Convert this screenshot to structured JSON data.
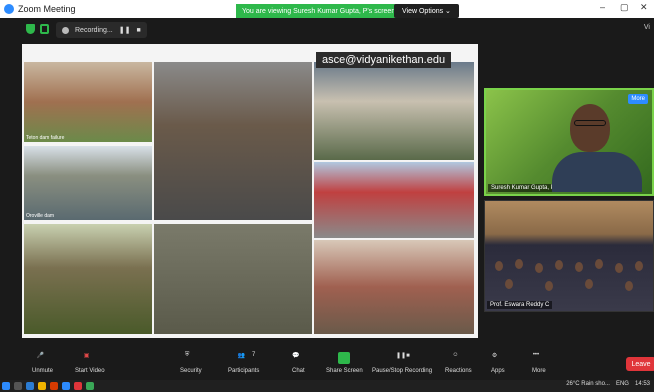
{
  "window": {
    "title": "Zoom Meeting"
  },
  "banner": {
    "text": "You are viewing Suresh Kumar Gupta, P's screen"
  },
  "view_options": {
    "label": "View Options ⌄"
  },
  "recording": {
    "label": "Recording..."
  },
  "top_right": {
    "view_label": "Vi"
  },
  "slide": {
    "title": "asce@vidyanikethan.edu",
    "photos": [
      {
        "caption": "Teton dam failure"
      },
      {
        "caption": "Oroville dam"
      },
      {
        "caption": ""
      },
      {
        "caption": ""
      },
      {
        "caption": ""
      },
      {
        "caption": ""
      },
      {
        "caption": ""
      },
      {
        "caption": ""
      },
      {
        "caption": ""
      }
    ]
  },
  "participants": {
    "speaker": {
      "name": "Suresh Kumar Gupta, P",
      "more": "More"
    },
    "audience": {
      "name": "Prof. Eswara Reddy C"
    }
  },
  "toolbar": {
    "unmute": "Unmute",
    "start_video": "Start Video",
    "security": "Security",
    "participants": "Participants",
    "participant_count": "7",
    "chat": "Chat",
    "share_screen": "Share Screen",
    "pause_stop_recording": "Pause/Stop Recording",
    "reactions": "Reactions",
    "apps": "Apps",
    "more": "More",
    "leave": "Leave"
  },
  "taskbar": {
    "weather": "26°C Rain sho...",
    "language": "ENG",
    "time": "14:53"
  },
  "colors": {
    "share_green": "#2eb84b",
    "leave_red": "#e0353a",
    "zoom_blue": "#2d8cff"
  }
}
